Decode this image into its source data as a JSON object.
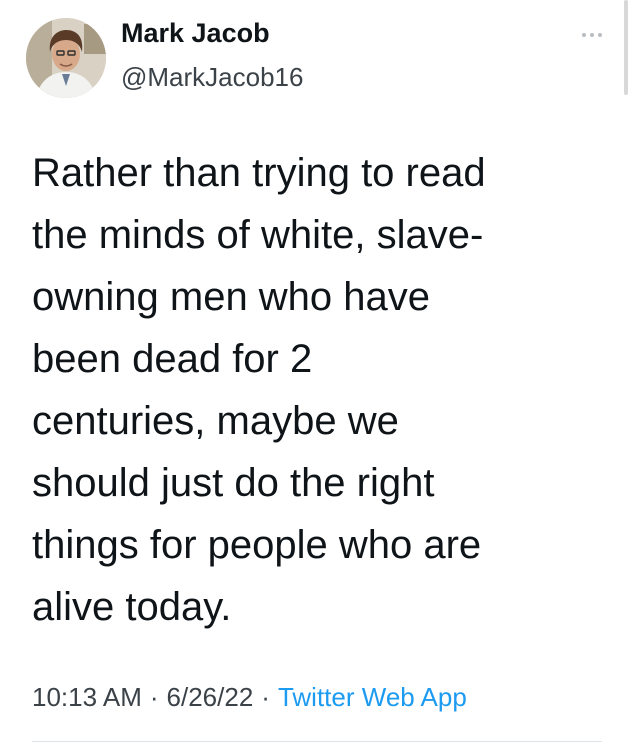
{
  "author": {
    "name": "Mark Jacob",
    "handle": "@MarkJacob16"
  },
  "tweet": {
    "text_lines": [
      "Rather than trying to read",
      "the minds of white, slave-",
      "owning men who have",
      "been dead for 2",
      "centuries, maybe we",
      "should just do the right",
      "things for people who are",
      "alive today."
    ],
    "time": "10:13 AM",
    "date": "6/26/22",
    "separator": "·",
    "source": "Twitter Web App"
  },
  "icons": {
    "more": "more-horizontal-icon",
    "avatar": "profile-photo"
  },
  "colors": {
    "text": "#0f1419",
    "secondary": "#3b4248",
    "link": "#1d9bf0"
  }
}
